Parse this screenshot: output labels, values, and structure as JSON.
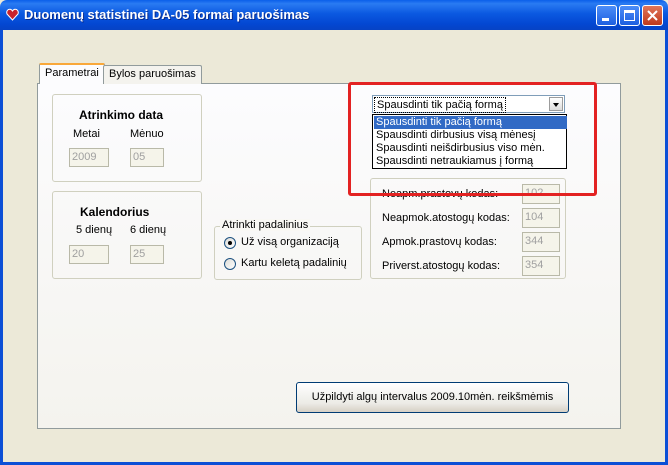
{
  "window": {
    "title": "Duomenų statistinei DA-05 formai paruošimas",
    "titlebar_color": "#0A5FEA",
    "caption_buttons": [
      "minimize-icon",
      "maximize-icon",
      "close-icon"
    ]
  },
  "tabs": [
    {
      "label": "Parametrai",
      "active": true
    },
    {
      "label": "Bylos paruošimas",
      "active": false
    }
  ],
  "atrinkimo": {
    "title": "Atrinkimo data",
    "metai_label": "Metai",
    "menuo_label": "Mėnuo",
    "metai_value": "2009",
    "menuo_value": "05"
  },
  "kalendorius": {
    "title": "Kalendorius",
    "label_5": "5 dienų",
    "label_6": "6 dienų",
    "value_5": "20",
    "value_6": "25"
  },
  "padaliniai": {
    "legend": "Atrinkti padalinius",
    "options": [
      {
        "label": "Už visą organizaciją",
        "checked": true
      },
      {
        "label": "Kartu keletą padalinių",
        "checked": false
      }
    ]
  },
  "print_combo": {
    "selected": "Spausdinti tik pačią formą",
    "options": [
      "Spausdinti tik pačią formą",
      "Spausdinti dirbusius visą mėnesį",
      "Spausdinti neišdirbusius viso mėn.",
      "Spausdinti netraukiamus į formą"
    ],
    "highlight_color": "#E32222",
    "selection_color": "#316AC5"
  },
  "codes": [
    {
      "label": "Neapm.prastovų kodas:",
      "value": "102"
    },
    {
      "label": "Neapmok.atostogų kodas:",
      "value": "104"
    },
    {
      "label": "Apmok.prastovų kodas:",
      "value": "344"
    },
    {
      "label": "Priverst.atostogų kodas:",
      "value": "354"
    }
  ],
  "fill_button": {
    "label": "Užpildyti algų intervalus 2009.10mėn. reikšmėmis"
  }
}
